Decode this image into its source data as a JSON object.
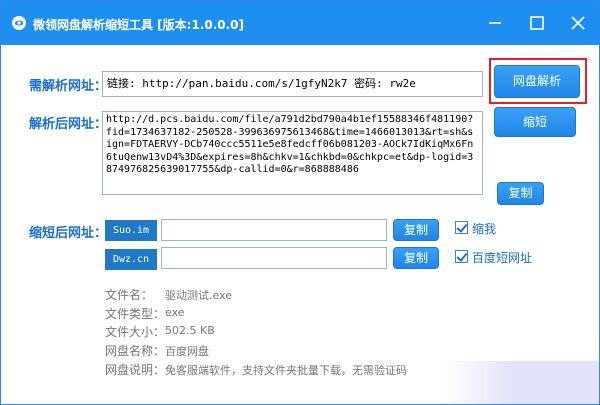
{
  "window": {
    "title": "微领网盘解析缩短工具 [版本:1.0.0.0]"
  },
  "labels": {
    "need_url": "需解析网址：",
    "parsed_url": "解析后网址：",
    "short_url": "缩短后网址："
  },
  "input": {
    "value": "链接: http://pan.baidu.com/s/1gfyN2k7 密码: rw2e"
  },
  "buttons": {
    "parse": "网盘解析",
    "shorten": "缩短",
    "copy": "复制"
  },
  "result": {
    "text": "http://d.pcs.baidu.com/file/a791d2bd790a4b1ef15588346f481190?fid=1734637182-250528-399636975613468&time=1466013013&rt=sh&sign=FDTAERVY-DCb740ccc5511e5e8fedcff06b081203-AOCk7IdKiqMx6Fn6tuQenw13vD4%3D&expires=8h&chkv=1&chkbd=0&chkpc=et&dp-logid=3874976825639017755&dp-callid=0&r=868888486"
  },
  "shorteners": [
    {
      "service": "Suo.im",
      "checkbox_label": "缩我"
    },
    {
      "service": "Dwz.cn",
      "checkbox_label": "百度短网址"
    }
  ],
  "file_info": [
    {
      "key": "文件名：",
      "value": "驱动测试.exe"
    },
    {
      "key": "文件类型：",
      "value": "exe"
    },
    {
      "key": "文件大小：",
      "value": "502.5 KB"
    },
    {
      "key": "网盘名称：",
      "value": "百度网盘"
    },
    {
      "key": "网盘说明：",
      "value": "免客服端软件，支持文件夹批量下载，无需验证码"
    }
  ],
  "colors": {
    "titlebar": "#1e8ff0",
    "accent": "#1b6fd1",
    "highlight": "#e0202a"
  }
}
